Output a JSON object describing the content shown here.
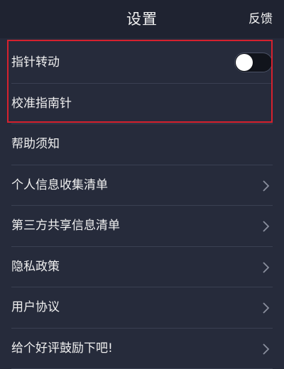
{
  "header": {
    "title": "设置",
    "action_label": "反馈"
  },
  "settings": {
    "rows": [
      {
        "label": "指针转动",
        "control": "toggle",
        "toggle_on": false
      },
      {
        "label": "校准指南针",
        "control": "none"
      },
      {
        "label": "帮助须知",
        "control": "none"
      },
      {
        "label": "个人信息收集清单",
        "control": "chevron"
      },
      {
        "label": "第三方共享信息清单",
        "control": "chevron"
      },
      {
        "label": "隐私政策",
        "control": "chevron"
      },
      {
        "label": "用户协议",
        "control": "chevron"
      },
      {
        "label": "给个好评鼓励下吧!",
        "control": "chevron"
      }
    ]
  },
  "icons": {
    "chevron": "chevron-right-icon"
  },
  "colors": {
    "background": "#262b3b",
    "header_background": "#1f2331",
    "divider": "#3a4052",
    "highlight": "#d6212e",
    "text": "#f0f0f0"
  }
}
